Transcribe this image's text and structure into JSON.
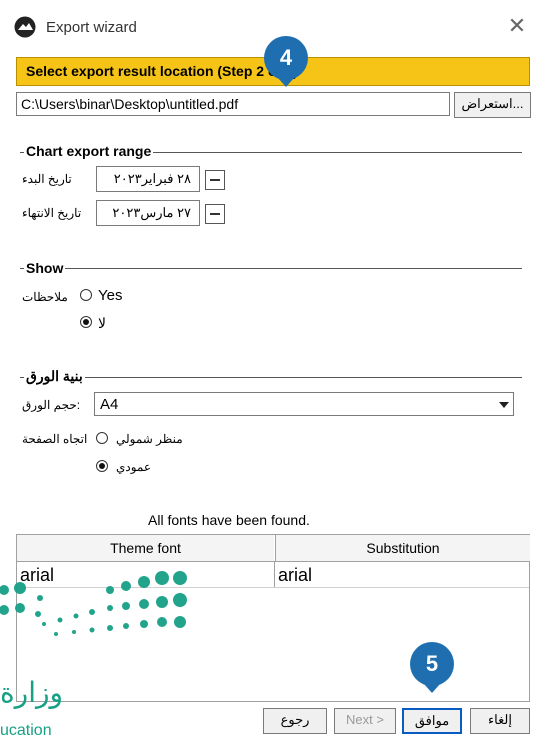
{
  "window": {
    "title": "Export wizard",
    "close_glyph": "✕",
    "icon": "app-logo-icon"
  },
  "step": {
    "banner_text": "Select export result location (Step 2 of 2)"
  },
  "file": {
    "path": "C:\\Users\\binar\\Desktop\\untitled.pdf",
    "browse_label": "استعراض..."
  },
  "chart_export_range": {
    "title": "Chart export range",
    "start_label": "تاريخ البدء",
    "start_value": "٢٨ فبراير٢٠٢٣",
    "end_label": "تاريخ الانتهاء",
    "end_value": "٢٧ مارس٢٠٢٣"
  },
  "show": {
    "title": "Show",
    "notes_label": "ملاحظات",
    "yes_label": "Yes",
    "no_label": "لا",
    "selected": "no"
  },
  "paper": {
    "title": "بنية الورق",
    "size_label": "حجم الورق:",
    "size_value": "A4",
    "orientation_label": "اتجاه الصفحة",
    "landscape_label": "منظر شمولي",
    "portrait_label": "عمودي",
    "selected": "portrait"
  },
  "fonts": {
    "status": "All fonts have been found.",
    "columns": [
      "Theme font",
      "Substitution"
    ],
    "rows": [
      [
        "arial",
        "arial"
      ]
    ]
  },
  "buttons": {
    "back": "رجوع",
    "next": "Next >",
    "ok": "موافق",
    "cancel": "إلغاء"
  },
  "badges": {
    "step4": "4",
    "step5": "5"
  },
  "watermark": {
    "text": "وزارة",
    "subtext": "ucation",
    "color": "#16a085"
  },
  "colors": {
    "banner": "#f6c416",
    "badge": "#1f6fb0"
  }
}
